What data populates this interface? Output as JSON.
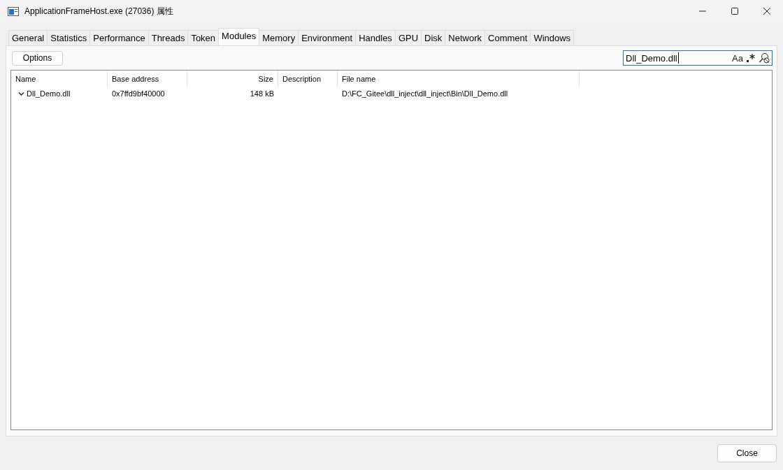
{
  "window": {
    "title": "ApplicationFrameHost.exe (27036) 属性"
  },
  "tabs": [
    {
      "label": "General",
      "selected": false
    },
    {
      "label": "Statistics",
      "selected": false
    },
    {
      "label": "Performance",
      "selected": false
    },
    {
      "label": "Threads",
      "selected": false
    },
    {
      "label": "Token",
      "selected": false
    },
    {
      "label": "Modules",
      "selected": true
    },
    {
      "label": "Memory",
      "selected": false
    },
    {
      "label": "Environment",
      "selected": false
    },
    {
      "label": "Handles",
      "selected": false
    },
    {
      "label": "GPU",
      "selected": false
    },
    {
      "label": "Disk",
      "selected": false
    },
    {
      "label": "Network",
      "selected": false
    },
    {
      "label": "Comment",
      "selected": false
    },
    {
      "label": "Windows",
      "selected": false
    }
  ],
  "options_button": "Options",
  "search": {
    "value": "Dll_Demo.dll",
    "case_toggle": "Aa"
  },
  "table": {
    "columns": [
      {
        "label": "Name",
        "right_aligned": false
      },
      {
        "label": "Base address",
        "right_aligned": false
      },
      {
        "label": "Size",
        "right_aligned": true
      },
      {
        "label": "Description",
        "right_aligned": false
      },
      {
        "label": "File name",
        "right_aligned": false
      }
    ],
    "rows": [
      {
        "expanded": true,
        "cells": [
          "Dll_Demo.dll",
          "0x7ffd9bf40000",
          "148 kB",
          null,
          "D:\\FC_Gitee\\dll_inject\\dll_inject\\Bin\\Dll_Demo.dll"
        ]
      }
    ]
  },
  "close_button": "Close"
}
